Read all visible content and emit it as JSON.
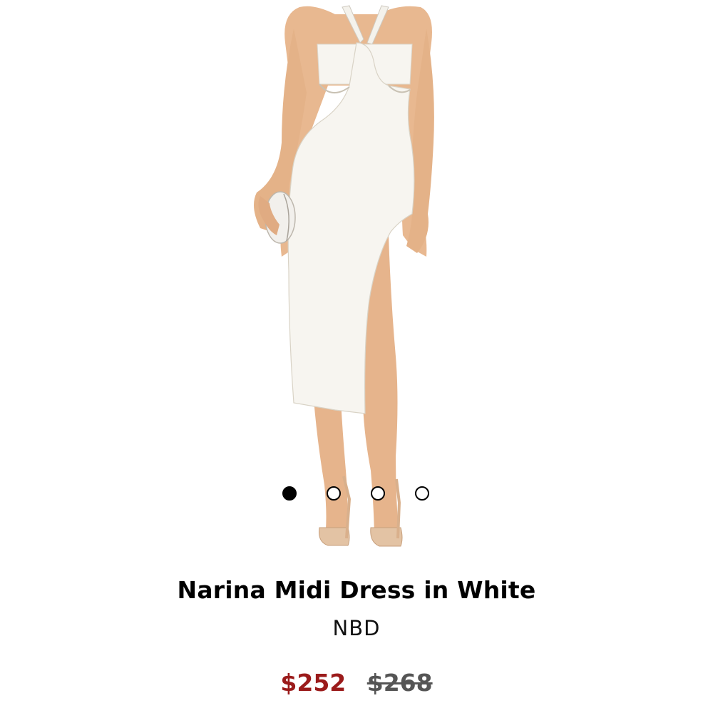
{
  "product": {
    "name": "Narina Midi Dress in White",
    "brand": "NBD",
    "sale_price": "$252",
    "original_price": "$268",
    "image_alt": "Model wearing a white halter midi dress with cut-outs and a high side slit, holding a white round clutch"
  },
  "carousel": {
    "total": 4,
    "active_index": 0
  },
  "colors": {
    "sale_price": "#9b1b1b",
    "original_price": "#555555",
    "dress": "#f7f5f0",
    "skin": "#e8b890"
  }
}
